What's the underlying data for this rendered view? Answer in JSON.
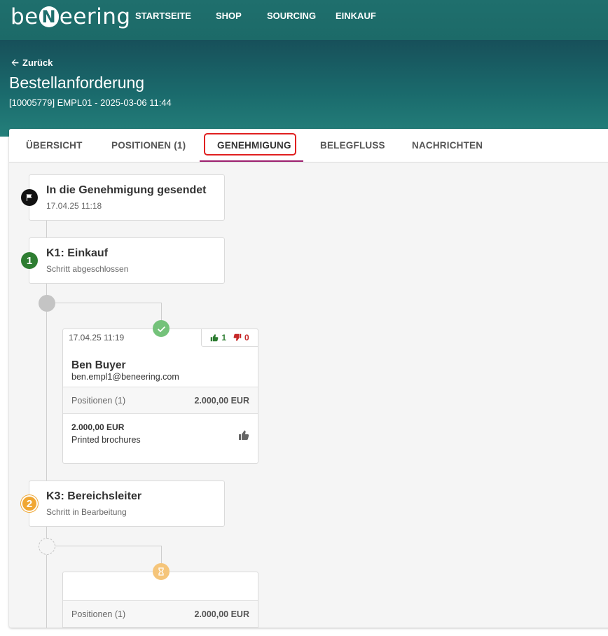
{
  "brand": {
    "logo_left": "be",
    "logo_badge": "N",
    "logo_right": "eering"
  },
  "nav": {
    "items": [
      "STARTSEITE",
      "SHOP",
      "SOURCING",
      "EINKAUF"
    ]
  },
  "header": {
    "back_label": "Zurück",
    "title": "Bestellanforderung",
    "subtitle": "[10005779] EMPL01 - 2025-03-06 11:44"
  },
  "tabs": {
    "items": [
      "ÜBERSICHT",
      "POSITIONEN (1)",
      "GENEHMIGUNG",
      "BELEGFLUSS",
      "NACHRICHTEN"
    ],
    "active": "GENEHMIGUNG"
  },
  "timeline": {
    "sent": {
      "title": "In die Genehmigung gesendet",
      "date": "17.04.25 11:18"
    },
    "step1": {
      "number": "1",
      "title": "K1: Einkauf",
      "status": "Schritt abgeschlossen",
      "approval": {
        "date": "17.04.25 11:19",
        "votes_up": "1",
        "votes_down": "0",
        "name": "Ben Buyer",
        "email": "ben.empl1@beneering.com",
        "positions_label": "Positionen (1)",
        "positions_total": "2.000,00 EUR",
        "item_price": "2.000,00 EUR",
        "item_desc": "Printed brochures"
      }
    },
    "step2": {
      "number": "2",
      "title": "K3: Bereichsleiter",
      "status": "Schritt in Bearbeitung",
      "approval": {
        "positions_label": "Positionen (1)",
        "positions_total": "2.000,00 EUR"
      }
    }
  },
  "colors": {
    "teal": "#1f6f6d",
    "approved_green": "#2e7d32",
    "in_progress": "#f0a733",
    "tab_accent": "#9c1f6e",
    "highlight_red": "#e02020"
  }
}
